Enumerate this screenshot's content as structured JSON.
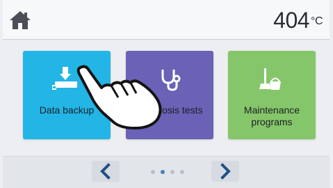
{
  "header": {
    "home_icon": "home-icon",
    "temperature_value": "404",
    "temperature_unit": "°C"
  },
  "tiles": [
    {
      "label": "Data backup",
      "icon": "data-backup-icon",
      "color": "#22b5e6"
    },
    {
      "label": "Diagnosis tests",
      "icon": "stethoscope-icon",
      "color": "#6a62b6"
    },
    {
      "label": "Maintenance programs",
      "icon": "broom-bucket-icon",
      "color": "#86c66a"
    }
  ],
  "pager": {
    "prev_icon": "chevron-left-icon",
    "next_icon": "chevron-right-icon",
    "page_count": 4,
    "current_page": 2,
    "accent_color": "#4d7fb8"
  },
  "overlay": {
    "icon": "pointing-hand-icon"
  }
}
